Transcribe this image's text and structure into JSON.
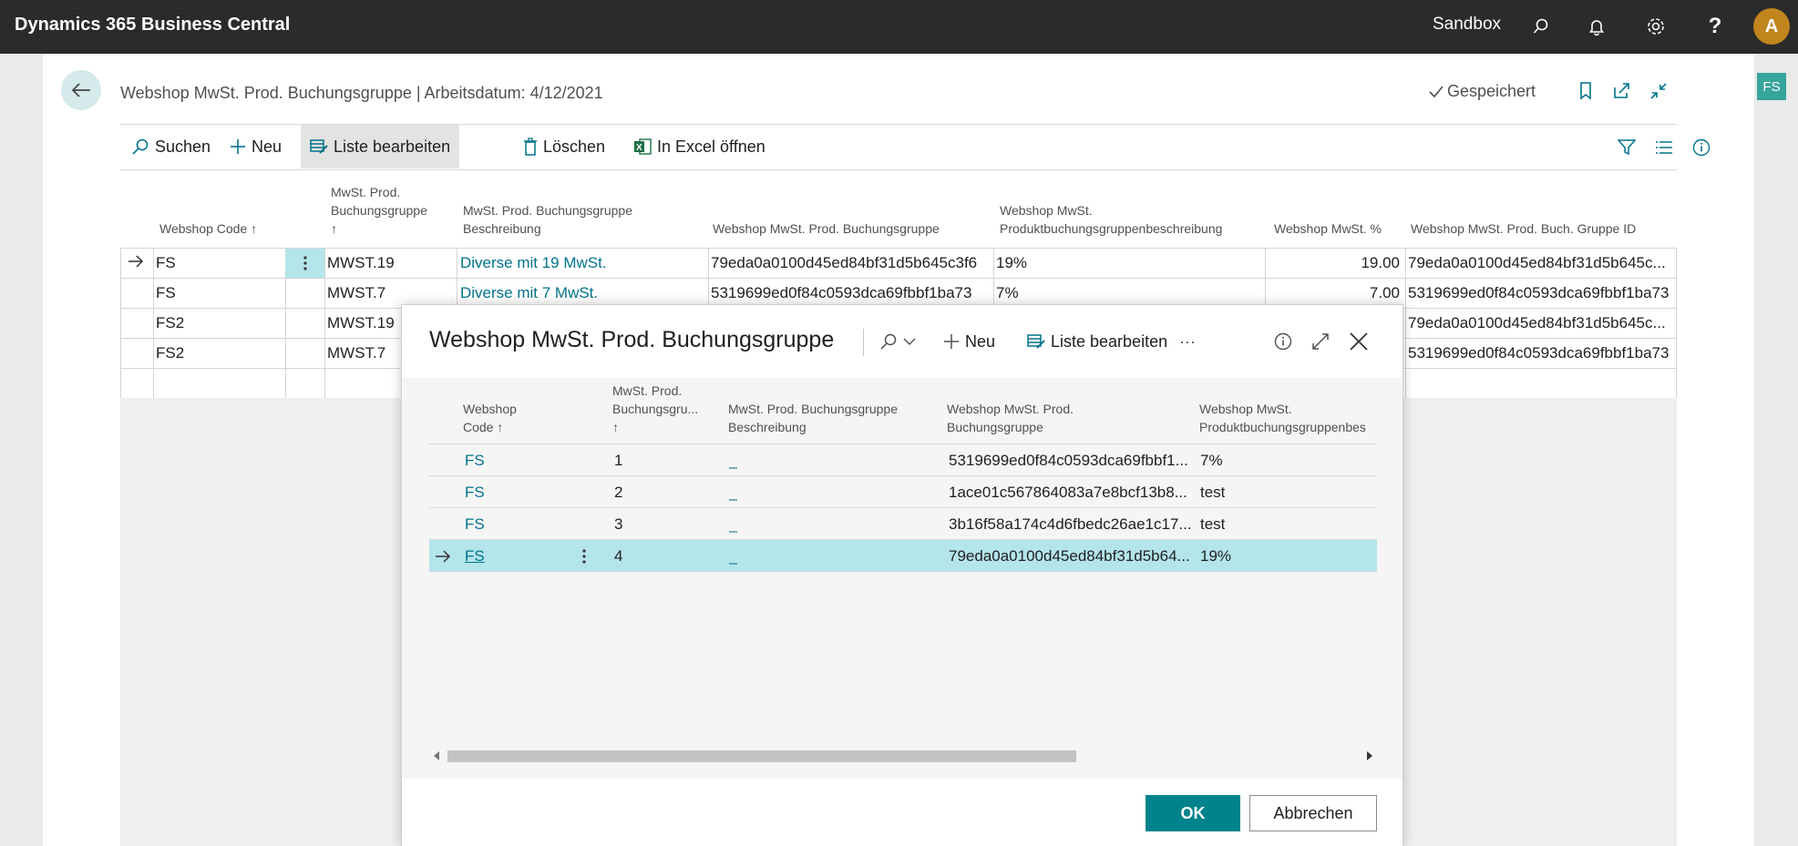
{
  "topbar": {
    "app_title": "Dynamics 365 Business Central",
    "environment": "Sandbox",
    "avatar_initial": "A"
  },
  "side_badge": "FS",
  "page": {
    "title": "Webshop MwSt. Prod. Buchungsgruppe | Arbeitsdatum: 4/12/2021",
    "saved_label": "Gespeichert",
    "actions": {
      "search": "Suchen",
      "new": "Neu",
      "edit_list": "Liste bearbeiten",
      "delete": "Löschen",
      "excel": "In Excel öffnen"
    }
  },
  "list": {
    "headers": {
      "webshop_code": "Webshop Code ↑",
      "prod_group_1": "MwSt. Prod.",
      "prod_group_2": "Buchungsgruppe",
      "prod_group_3": "↑",
      "desc_1": "MwSt. Prod. Buchungsgruppe",
      "desc_2": "Beschreibung",
      "ws_group": "Webshop MwSt. Prod. Buchungsgruppe",
      "ws_desc_1": "Webshop MwSt.",
      "ws_desc_2": "Produktbuchungsgruppenbeschreibung",
      "ws_pct": "Webshop MwSt. %",
      "ws_id": "Webshop MwSt. Prod. Buch. Gruppe ID"
    },
    "rows": [
      {
        "code": "FS",
        "group": "MWST.19",
        "desc": "Diverse mit 19 MwSt.",
        "ws_group": "79eda0a0100d45ed84bf31d5b645c3f6",
        "ws_desc": "19%",
        "pct": "19.00",
        "id": "79eda0a0100d45ed84bf31d5b645c..."
      },
      {
        "code": "FS",
        "group": "MWST.7",
        "desc": "Diverse mit 7 MwSt.",
        "ws_group": "5319699ed0f84c0593dca69fbbf1ba73",
        "ws_desc": "7%",
        "pct": "7.00",
        "id": "5319699ed0f84c0593dca69fbbf1ba73"
      },
      {
        "code": "FS2",
        "group": "MWST.19",
        "id": "79eda0a0100d45ed84bf31d5b645c..."
      },
      {
        "code": "FS2",
        "group": "MWST.7",
        "id": "5319699ed0f84c0593dca69fbbf1ba73"
      }
    ]
  },
  "dialog": {
    "title": "Webshop MwSt. Prod. Buchungsgruppe",
    "actions": {
      "new": "Neu",
      "edit_list": "Liste bearbeiten",
      "more": "···"
    },
    "headers": {
      "code_1": "Webshop",
      "code_2": "Code ↑",
      "grp_1": "MwSt. Prod.",
      "grp_2": "Buchungsgru...",
      "grp_3": "↑",
      "desc_1": "MwSt. Prod. Buchungsgruppe",
      "desc_2": "Beschreibung",
      "ws_1": "Webshop MwSt. Prod.",
      "ws_2": "Buchungsgruppe",
      "wsd_1": "Webshop MwSt.",
      "wsd_2": "Produktbuchungsgruppenbes"
    },
    "rows": [
      {
        "code": "FS",
        "grp": "1",
        "desc": "_",
        "ws": "5319699ed0f84c0593dca69fbbf1...",
        "wsd": "7%"
      },
      {
        "code": "FS",
        "grp": "2",
        "desc": "_",
        "ws": "1ace01c567864083a7e8bcf13b8...",
        "wsd": "test"
      },
      {
        "code": "FS",
        "grp": "3",
        "desc": "_",
        "ws": "3b16f58a174c4d6fbedc26ae1c17...",
        "wsd": "test"
      },
      {
        "code": "FS",
        "grp": "4",
        "desc": "_",
        "ws": "79eda0a0100d45ed84bf31d5b64...",
        "wsd": "19%"
      }
    ],
    "ok_label": "OK",
    "cancel_label": "Abbrechen"
  },
  "colors": {
    "topbar": "#2b2b2b",
    "accent": "#00838d",
    "link": "#00738a",
    "selected_row": "#b3e5ea",
    "avatar": "#c0851d",
    "badge": "#36a59b"
  }
}
